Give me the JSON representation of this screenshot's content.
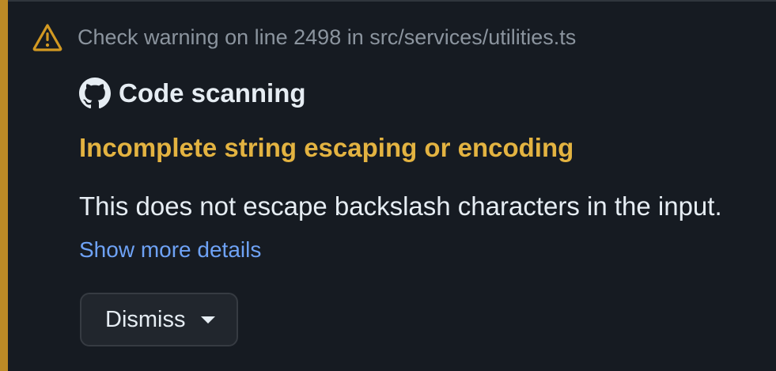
{
  "header": {
    "text": "Check warning on line 2498 in src/services/utilities.ts",
    "icon": "alert-triangle-icon"
  },
  "tool": {
    "name": "Code scanning",
    "icon": "github-mark-icon"
  },
  "alert": {
    "title": "Incomplete string escaping or encoding",
    "description": "This does not escape backslash characters in the input.",
    "details_link": "Show more details"
  },
  "actions": {
    "dismiss_label": "Dismiss",
    "dismiss_icon": "caret-down-icon"
  },
  "colors": {
    "background": "#161b22",
    "accent_bar": "#bb8a26",
    "warning_title": "#e3b341",
    "link": "#6ea2f5",
    "muted_text": "#8b949e",
    "primary_text": "#e6edf3",
    "button_bg": "#21262d"
  }
}
